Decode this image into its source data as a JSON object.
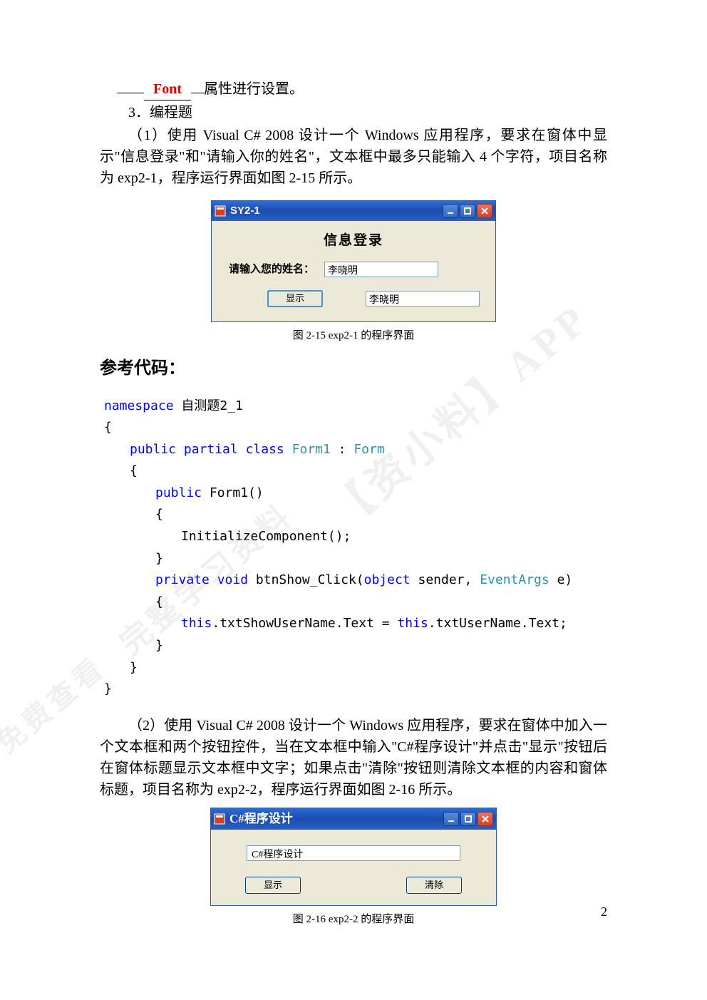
{
  "text": {
    "line1_lead": "",
    "line1_font": "Font",
    "line1_rest": "属性进行设置。",
    "line2": "3．编程题",
    "para1": "（1）使用 Visual C# 2008 设计一个 Windows 应用程序，要求在窗体中显示\"信息登录\"和\"请输入你的姓名\"，文本框中最多只能输入 4 个字符，项目名称为 exp2-1，程序运行界面如图 2-15 所示。",
    "caption1": "图 2-15 exp2-1 的程序界面",
    "heading": "参考代码：",
    "para2": "（2）使用 Visual C# 2008 设计一个 Windows 应用程序，要求在窗体中加入一个文本框和两个按钮控件，当在文本框中输入\"C#程序设计\"并点击\"显示\"按钮后在窗体标题显示文本框中文字；如果点击\"清除\"按钮则清除文本框的内容和窗体标题，项目名称为 exp2-2，程序运行界面如图 2-16 所示。",
    "caption2": "图 2-16 exp2-2 的程序界面",
    "page_num": "2"
  },
  "win1": {
    "title": "SY2-1",
    "heading": "信息登录",
    "label": "请输入您的姓名：",
    "value": "李晓明",
    "button": "显示",
    "output": "李晓明"
  },
  "code": {
    "l1a": "namespace",
    "l1b": " 自测题2_1",
    "l2": "{",
    "l3a": "public",
    "l3b": " ",
    "l3c": "partial",
    "l3d": " ",
    "l3e": "class",
    "l3f": " ",
    "l3g": "Form1",
    "l3h": " : ",
    "l3i": "Form",
    "l4": "{",
    "l5a": "public",
    "l5b": " Form1()",
    "l6": "{",
    "l7": "InitializeComponent();",
    "l8": "}",
    "l9a": "private",
    "l9b": " ",
    "l9c": "void",
    "l9d": " btnShow_Click(",
    "l9e": "object",
    "l9f": " sender, ",
    "l9g": "EventArgs",
    "l9h": " e)",
    "l10": "{",
    "l11a": "this",
    "l11b": ".txtShowUserName.Text = ",
    "l11c": "this",
    "l11d": ".txtUserName.Text;",
    "l12": "}",
    "l13": "}",
    "l14": "}"
  },
  "win2": {
    "title": "C#程序设计",
    "input": "C#程序设计",
    "btn1": "显示",
    "btn2": "清除"
  },
  "watermark": {
    "wm1": "【资小料】APP",
    "wm2": "完整学习资料",
    "wm3": "免费查看"
  }
}
